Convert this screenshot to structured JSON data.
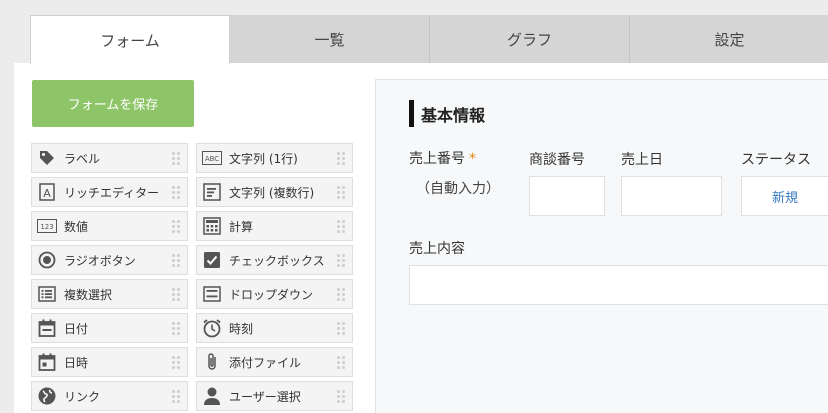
{
  "tabs": [
    {
      "label": "フォーム",
      "active": true
    },
    {
      "label": "一覧",
      "active": false
    },
    {
      "label": "グラフ",
      "active": false
    },
    {
      "label": "設定",
      "active": false
    }
  ],
  "save_button": {
    "label": "フォームを保存",
    "color": "#8fc569"
  },
  "palette": [
    {
      "label": "ラベル",
      "icon": "tag-icon"
    },
    {
      "label": "文字列 (1行)",
      "icon": "abc-icon"
    },
    {
      "label": "リッチエディター",
      "icon": "rich-editor-icon"
    },
    {
      "label": "文字列 (複数行)",
      "icon": "multiline-text-icon"
    },
    {
      "label": "数値",
      "icon": "number-icon"
    },
    {
      "label": "計算",
      "icon": "calculator-icon"
    },
    {
      "label": "ラジオボタン",
      "icon": "radio-icon"
    },
    {
      "label": "チェックボックス",
      "icon": "checkbox-icon"
    },
    {
      "label": "複数選択",
      "icon": "multi-select-icon"
    },
    {
      "label": "ドロップダウン",
      "icon": "dropdown-icon"
    },
    {
      "label": "日付",
      "icon": "date-icon"
    },
    {
      "label": "時刻",
      "icon": "clock-icon"
    },
    {
      "label": "日時",
      "icon": "datetime-icon"
    },
    {
      "label": "添付ファイル",
      "icon": "paperclip-icon"
    },
    {
      "label": "リンク",
      "icon": "globe-icon"
    },
    {
      "label": "ユーザー選択",
      "icon": "user-icon"
    }
  ],
  "form": {
    "section_title": "基本情報",
    "fields": {
      "sales_number": {
        "label": "売上番号",
        "required_mark": "*",
        "auto_text": "（自動入力）"
      },
      "deal_number": {
        "label": "商談番号"
      },
      "sales_date": {
        "label": "売上日"
      },
      "status": {
        "label": "ステータス",
        "value": "新規"
      },
      "sales_content": {
        "label": "売上内容"
      }
    }
  }
}
